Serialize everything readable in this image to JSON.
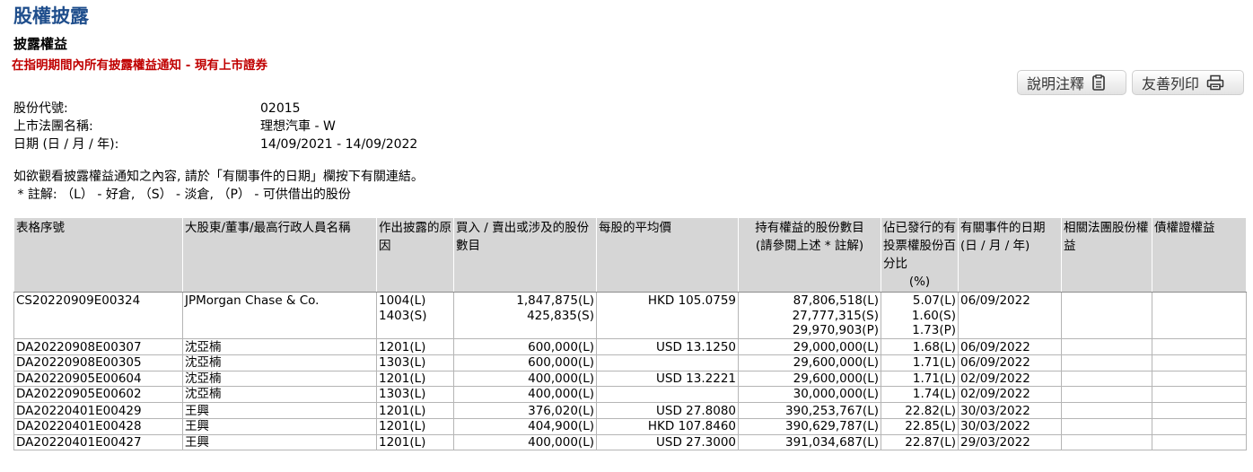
{
  "page": {
    "title": "股權披露",
    "section_title": "披露權益",
    "subtitle": "在指明期間內所有披露權益通知 - 現有上市證券"
  },
  "buttons": {
    "notes_label": "說明注釋",
    "print_label": "友善列印"
  },
  "info": {
    "stock_code_label": "股份代號:",
    "stock_code": "02015",
    "company_label": "上市法團名稱:",
    "company": "理想汽車 - W",
    "date_label": "日期 (日 / 月 / 年):",
    "date_range": "14/09/2021 - 14/09/2022"
  },
  "notes": {
    "line1": "如欲觀看披露權益通知之內容, 請於「有關事件的日期」欄按下有關連結。",
    "line2": " * 註解: （L） - 好倉, （S） - 淡倉, （P） - 可供借出的股份"
  },
  "table": {
    "headers": {
      "form_no": "表格序號",
      "name": "大股東/董事/最高行政人員名稱",
      "reason": "作出披露的原因",
      "shares_involved": "買入 / 賣出或涉及的股份數目",
      "avg_price": "每股的平均價",
      "shares_held_1": "持有權益的股份數目",
      "shares_held_2": "(請參閱上述 * 註解)",
      "pct": "佔已發行的有投票權股份百分比",
      "pct_unit": "(%)",
      "event_date": "有關事件的日期 (日 / 月 / 年)",
      "assoc": "相關法團股份權益",
      "debenture": "債權證權益"
    },
    "rows": [
      {
        "form_no": "CS20220909E00324",
        "name": "JPMorgan Chase & Co.",
        "reason": [
          "1004(L)",
          "1403(S)"
        ],
        "shares_involved": [
          "1,847,875(L)",
          "425,835(S)"
        ],
        "avg_price": "HKD 105.0759",
        "shares_held": [
          "87,806,518(L)",
          "27,777,315(S)",
          "29,970,903(P)"
        ],
        "pct": [
          "5.07(L)",
          "1.60(S)",
          "1.73(P)"
        ],
        "event_date": "06/09/2022"
      },
      {
        "form_no": "DA20220908E00307",
        "name": "沈亞楠",
        "reason": [
          "1201(L)"
        ],
        "shares_involved": [
          "600,000(L)"
        ],
        "avg_price": "USD 13.1250",
        "shares_held": [
          "29,000,000(L)"
        ],
        "pct": [
          "1.68(L)"
        ],
        "event_date": "06/09/2022"
      },
      {
        "form_no": "DA20220908E00305",
        "name": "沈亞楠",
        "reason": [
          "1303(L)"
        ],
        "shares_involved": [
          "600,000(L)"
        ],
        "avg_price": "",
        "shares_held": [
          "29,600,000(L)"
        ],
        "pct": [
          "1.71(L)"
        ],
        "event_date": "06/09/2022"
      },
      {
        "form_no": "DA20220905E00604",
        "name": "沈亞楠",
        "reason": [
          "1201(L)"
        ],
        "shares_involved": [
          "400,000(L)"
        ],
        "avg_price": "USD 13.2221",
        "shares_held": [
          "29,600,000(L)"
        ],
        "pct": [
          "1.71(L)"
        ],
        "event_date": "02/09/2022"
      },
      {
        "form_no": "DA20220905E00602",
        "name": "沈亞楠",
        "reason": [
          "1303(L)"
        ],
        "shares_involved": [
          "400,000(L)"
        ],
        "avg_price": "",
        "shares_held": [
          "30,000,000(L)"
        ],
        "pct": [
          "1.74(L)"
        ],
        "event_date": "02/09/2022"
      },
      {
        "form_no": "DA20220401E00429",
        "name": "王興",
        "reason": [
          "1201(L)"
        ],
        "shares_involved": [
          "376,020(L)"
        ],
        "avg_price": "USD 27.8080",
        "shares_held": [
          "390,253,767(L)"
        ],
        "pct": [
          "22.82(L)"
        ],
        "event_date": "30/03/2022"
      },
      {
        "form_no": "DA20220401E00428",
        "name": "王興",
        "reason": [
          "1201(L)"
        ],
        "shares_involved": [
          "404,900(L)"
        ],
        "avg_price": "HKD 107.8460",
        "shares_held": [
          "390,629,787(L)"
        ],
        "pct": [
          "22.85(L)"
        ],
        "event_date": "30/03/2022"
      },
      {
        "form_no": "DA20220401E00427",
        "name": "王興",
        "reason": [
          "1201(L)"
        ],
        "shares_involved": [
          "400,000(L)"
        ],
        "avg_price": "USD 27.3000",
        "shares_held": [
          "391,034,687(L)"
        ],
        "pct": [
          "22.87(L)"
        ],
        "event_date": "29/03/2022"
      }
    ]
  }
}
